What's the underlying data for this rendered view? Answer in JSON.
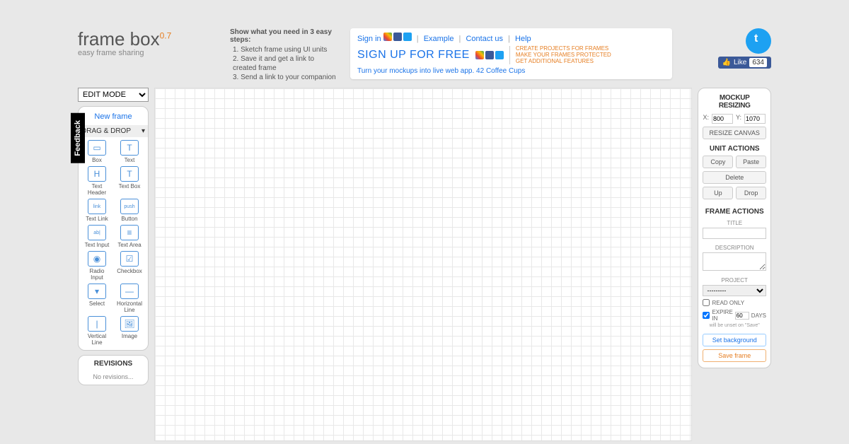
{
  "brand": {
    "name": "frame box",
    "version": "0.7",
    "tagline": "easy frame sharing"
  },
  "steps": {
    "title": "Show what you need in 3 easy steps:",
    "items": [
      "1. Sketch frame using UI units",
      "2. Save it and get a link to created frame",
      "3. Send a link to your companion"
    ]
  },
  "auth": {
    "signin": "Sign in",
    "example": "Example",
    "contact": "Contact us",
    "help": "Help",
    "signup": "SIGN UP FOR FREE",
    "benefits": [
      "CREATE PROJECTS FOR FRAMES",
      "MAKE YOUR FRAMES PROTECTED",
      "GET ADDITIONAL FEATURES"
    ],
    "promo": "Turn your mockups into live web app. 42 Coffee Cups"
  },
  "like": {
    "label": "Like",
    "count": "634"
  },
  "mode": {
    "value": "EDIT MODE"
  },
  "feedback": "Feedback",
  "sidebar": {
    "new_frame": "New frame",
    "drag_drop": "DRAG & DROP",
    "tools": [
      {
        "label": "Box",
        "glyph": "▭"
      },
      {
        "label": "Text",
        "glyph": "T"
      },
      {
        "label": "Text Header",
        "glyph": "H"
      },
      {
        "label": "Text Box",
        "glyph": "T"
      },
      {
        "label": "Text Link",
        "glyph": "link"
      },
      {
        "label": "Button",
        "glyph": "push"
      },
      {
        "label": "Text Input",
        "glyph": "ab|"
      },
      {
        "label": "Text Area",
        "glyph": "≡"
      },
      {
        "label": "Radio Input",
        "glyph": "◉"
      },
      {
        "label": "Checkbox",
        "glyph": "☑"
      },
      {
        "label": "Select",
        "glyph": "▾"
      },
      {
        "label": "Horizontal Line",
        "glyph": "—"
      },
      {
        "label": "Vertical Line",
        "glyph": "|"
      },
      {
        "label": "Image",
        "glyph": "🖼"
      }
    ]
  },
  "revisions": {
    "title": "REVISIONS",
    "empty": "No revisions..."
  },
  "right": {
    "resizing_title": "MOCKUP RESIZING",
    "x_label": "X:",
    "x_val": "800",
    "y_label": "Y:",
    "y_val": "1070",
    "resize_btn": "RESIZE CANVAS",
    "unit_actions_title": "UNIT ACTIONS",
    "copy": "Copy",
    "paste": "Paste",
    "delete": "Delete",
    "up": "Up",
    "drop": "Drop",
    "frame_actions_title": "FRAME ACTIONS",
    "title_label": "TITLE",
    "desc_label": "DESCRIPTION",
    "project_label": "PROJECT",
    "project_value": "---------",
    "readonly": "READ ONLY",
    "expire_pre": "EXPIRE IN",
    "expire_val": "60",
    "expire_post": "DAYS",
    "expire_hint": "will be unset on \"Save\"",
    "set_bg": "Set background",
    "save": "Save frame"
  }
}
